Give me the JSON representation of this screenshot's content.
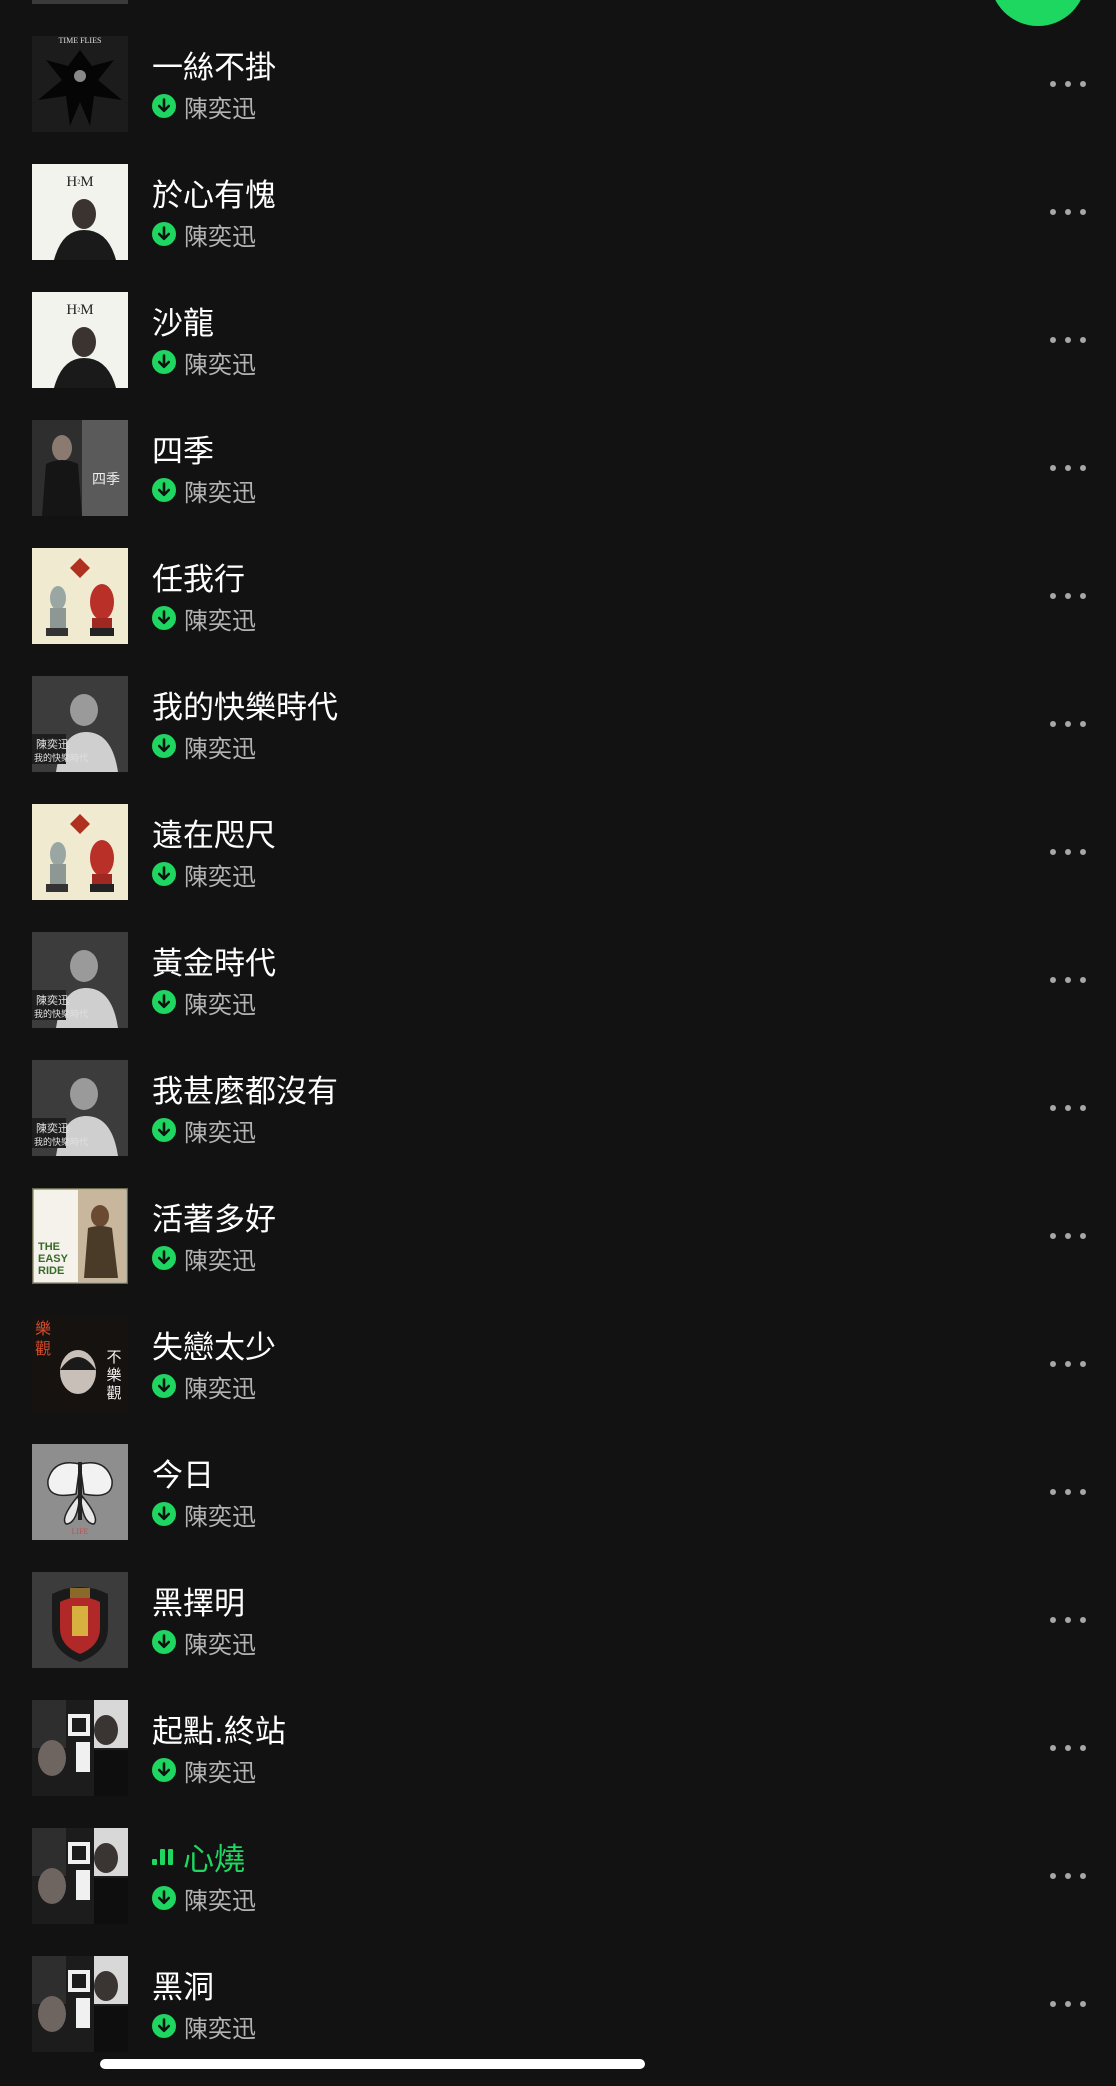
{
  "colors": {
    "background": "#121212",
    "accent": "#1ed760",
    "primary_text": "#ffffff",
    "secondary_text": "#b3b3b3"
  },
  "icons": {
    "download": "download-arrow-circle-icon",
    "more": "more-horizontal-icon",
    "playing": "equalizer-bars-icon"
  },
  "tracks": [
    {
      "title": "一絲不掛",
      "artist": "陳奕迅",
      "downloaded": true,
      "playing": false,
      "cover": "time-flies-album-art"
    },
    {
      "title": "於心有愧",
      "artist": "陳奕迅",
      "downloaded": true,
      "playing": false,
      "cover": "hm-album-art"
    },
    {
      "title": "沙龍",
      "artist": "陳奕迅",
      "downloaded": true,
      "playing": false,
      "cover": "hm-album-art"
    },
    {
      "title": "四季",
      "artist": "陳奕迅",
      "downloaded": true,
      "playing": false,
      "cover": "four-seasons-album-art"
    },
    {
      "title": "任我行",
      "artist": "陳奕迅",
      "downloaded": true,
      "playing": false,
      "cover": "rice-and-shine-album-art"
    },
    {
      "title": "我的快樂時代",
      "artist": "陳奕迅",
      "downloaded": true,
      "playing": false,
      "cover": "happy-times-album-art"
    },
    {
      "title": "遠在咫尺",
      "artist": "陳奕迅",
      "downloaded": true,
      "playing": false,
      "cover": "rice-and-shine-album-art"
    },
    {
      "title": "黃金時代",
      "artist": "陳奕迅",
      "downloaded": true,
      "playing": false,
      "cover": "happy-times-album-art"
    },
    {
      "title": "我甚麼都沒有",
      "artist": "陳奕迅",
      "downloaded": true,
      "playing": false,
      "cover": "happy-times-album-art"
    },
    {
      "title": "活著多好",
      "artist": "陳奕迅",
      "downloaded": true,
      "playing": false,
      "cover": "the-easy-ride-album-art"
    },
    {
      "title": "失戀太少",
      "artist": "陳奕迅",
      "downloaded": true,
      "playing": false,
      "cover": "pessimistic-album-art"
    },
    {
      "title": "今日",
      "artist": "陳奕迅",
      "downloaded": true,
      "playing": false,
      "cover": "life-album-art"
    },
    {
      "title": "黑擇明",
      "artist": "陳奕迅",
      "downloaded": true,
      "playing": false,
      "cover": "crest-album-art"
    },
    {
      "title": "起點.終站",
      "artist": "陳奕迅",
      "downloaded": true,
      "playing": false,
      "cover": "u87-album-art"
    },
    {
      "title": "心燒",
      "artist": "陳奕迅",
      "downloaded": true,
      "playing": true,
      "cover": "u87-album-art"
    },
    {
      "title": "黑洞",
      "artist": "陳奕迅",
      "downloaded": true,
      "playing": false,
      "cover": "u87-album-art"
    }
  ]
}
